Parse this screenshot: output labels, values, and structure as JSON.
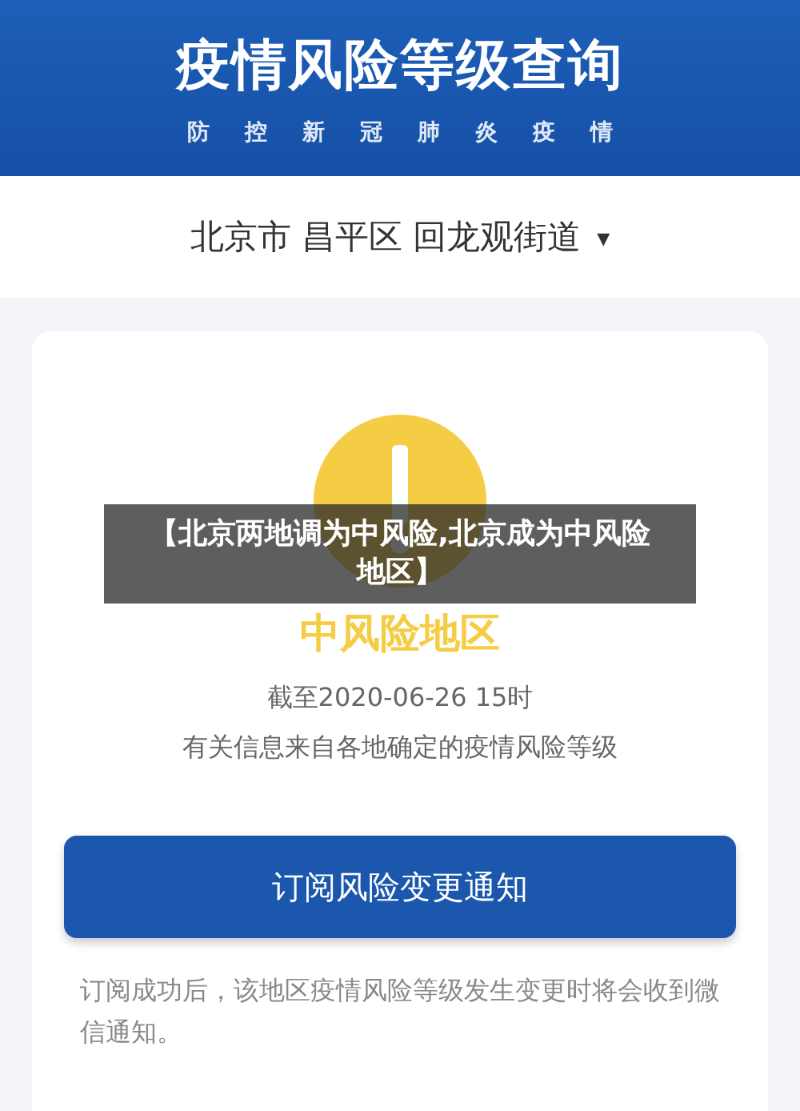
{
  "header": {
    "title": "疫情风险等级查询",
    "subtitle": [
      "防",
      "控",
      "新",
      "冠",
      "肺",
      "炎",
      "疫",
      "情"
    ]
  },
  "location": {
    "parts": [
      "北京市",
      "昌平区",
      "回龙观街道"
    ],
    "caret": "▾"
  },
  "result": {
    "color": "#f5cd45",
    "level": "中风险地区",
    "as_of": "截至2020-06-26 15时",
    "source": "有关信息来自各地确定的疫情风险等级"
  },
  "subscribe_button": "订阅风险变更通知",
  "note": "订阅成功后，该地区疫情风险等级发生变更时将会收到微信通知。",
  "overlay_caption": "【北京两地调为中风险,北京成为中风险地区】"
}
